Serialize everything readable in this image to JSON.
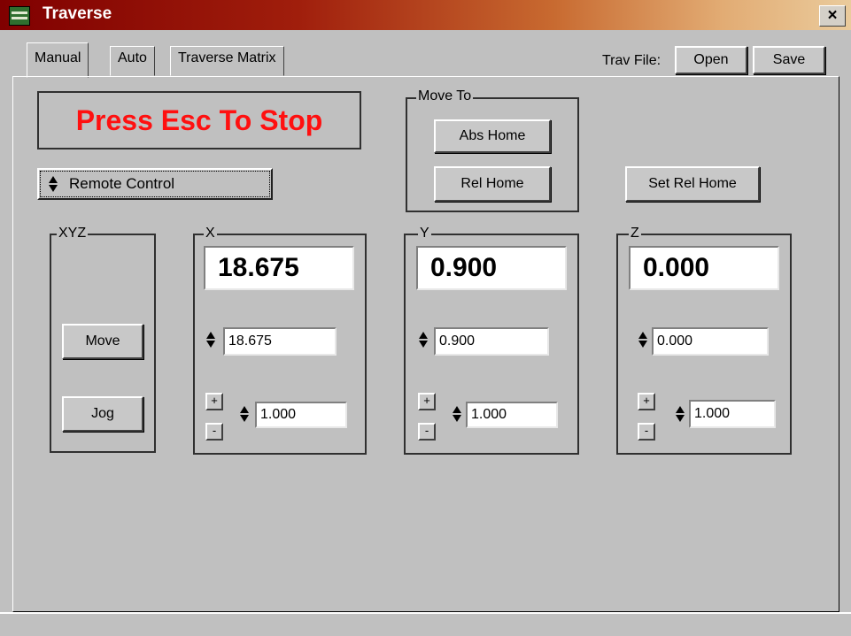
{
  "window": {
    "title": "Traverse",
    "close_symbol": "×"
  },
  "tabs": [
    {
      "label": "Manual",
      "active": true
    },
    {
      "label": "Auto",
      "active": false
    },
    {
      "label": "Traverse Matrix",
      "active": false
    }
  ],
  "trav_file": {
    "label": "Trav File:",
    "open_label": "Open",
    "save_label": "Save"
  },
  "stop_message": "Press Esc To Stop",
  "control_mode": {
    "value": "Remote Control"
  },
  "move_to": {
    "title": "Move To",
    "abs_home_label": "Abs Home",
    "rel_home_label": "Rel Home"
  },
  "set_rel_home_label": "Set Rel Home",
  "xyz": {
    "title": "XYZ",
    "move_label": "Move",
    "jog_label": "Jog"
  },
  "axes": {
    "x": {
      "title": "X",
      "display": "18.675",
      "position": "18.675",
      "step": "1.000"
    },
    "y": {
      "title": "Y",
      "display": "0.900",
      "position": "0.900",
      "step": "1.000"
    },
    "z": {
      "title": "Z",
      "display": "0.000",
      "position": "0.000",
      "step": "1.000"
    }
  },
  "step_buttons": {
    "plus": "+",
    "minus": "-"
  },
  "colors": {
    "stop_text": "#ff1010",
    "title_bar_start": "#800000",
    "background": "#c0c0c0"
  }
}
